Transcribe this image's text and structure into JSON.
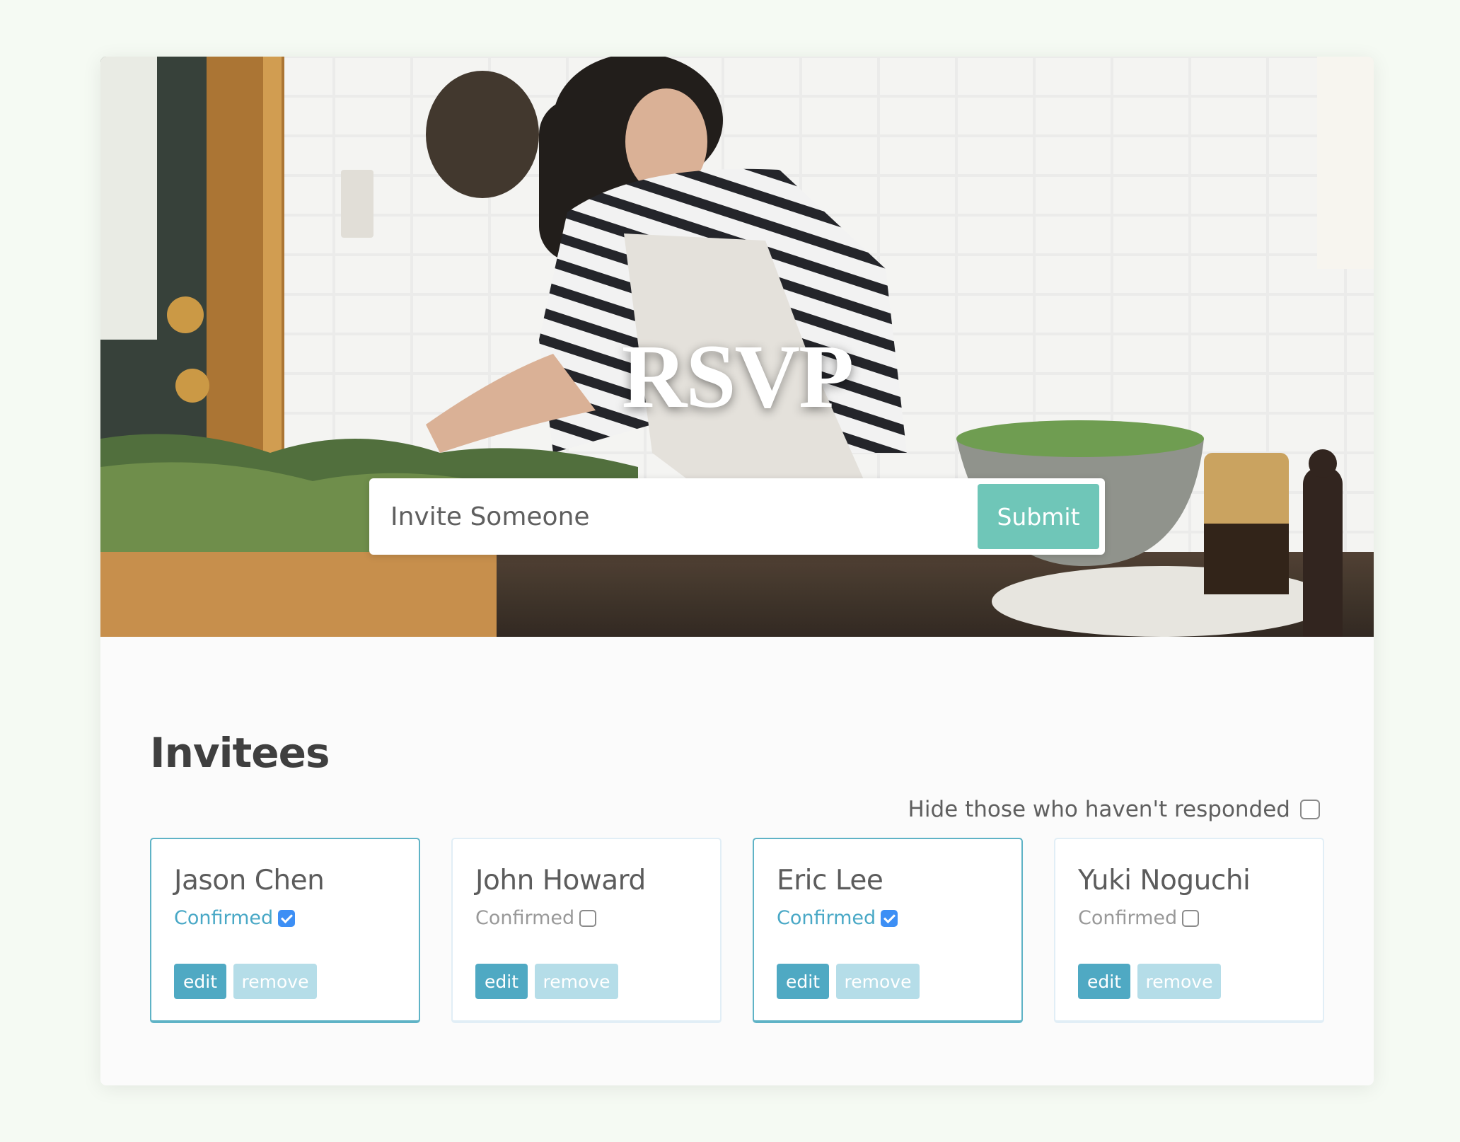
{
  "hero": {
    "title": "RSVP",
    "input_placeholder": "Invite Someone",
    "submit_label": "Submit"
  },
  "invitees": {
    "heading": "Invitees",
    "filter_label": "Hide those who haven't responded",
    "filter_checked": false,
    "items": [
      {
        "name": "Jason Chen",
        "status_label": "Confirmed",
        "confirmed": true,
        "edit_label": "edit",
        "remove_label": "remove"
      },
      {
        "name": "John Howard",
        "status_label": "Confirmed",
        "confirmed": false,
        "edit_label": "edit",
        "remove_label": "remove"
      },
      {
        "name": "Eric Lee",
        "status_label": "Confirmed",
        "confirmed": true,
        "edit_label": "edit",
        "remove_label": "remove"
      },
      {
        "name": "Yuki Noguchi",
        "status_label": "Confirmed",
        "confirmed": false,
        "edit_label": "edit",
        "remove_label": "remove"
      }
    ]
  },
  "colors": {
    "accent_teal": "#6fc6b8",
    "edit_button": "#4fa9c3",
    "remove_button": "#b5dde8",
    "confirmed_text": "#49a8c6",
    "checkbox_checked": "#3d8ff5"
  }
}
